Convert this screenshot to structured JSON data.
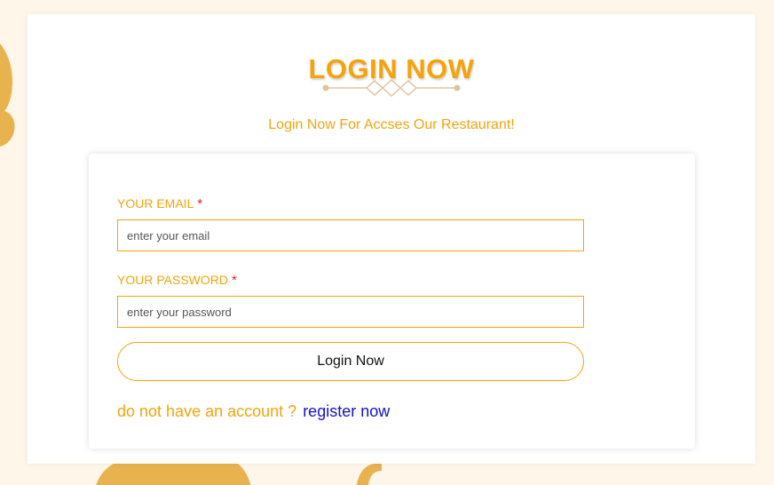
{
  "colors": {
    "accent": "#f5a30c",
    "link": "#1212c8",
    "required": "#e0202a",
    "background": "#fdf6e9"
  },
  "header": {
    "title": "LOGIN NOW",
    "subtitle": "Login Now For Accses Our Restaurant!"
  },
  "form": {
    "email_label": "YOUR EMAIL",
    "email_placeholder": "enter your email",
    "password_label": "YOUR PASSWORD",
    "password_placeholder": "enter your password",
    "required_mark": "*",
    "submit_label": "Login Now"
  },
  "footer": {
    "prompt": "do not have an account ?",
    "register_link": "register now"
  },
  "icons": {
    "divider": "ornament-divider-icon"
  }
}
